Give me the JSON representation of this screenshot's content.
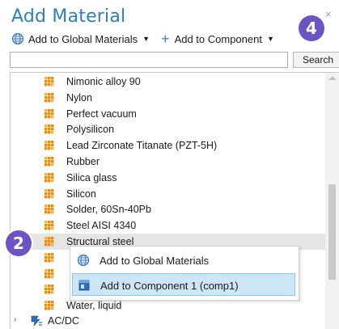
{
  "window": {
    "title": "Add Material",
    "close_glyph": "×"
  },
  "toolbar": {
    "global_label": "Add to Global Materials",
    "global_caret": "▼",
    "component_label": "Add to Component",
    "component_caret": "▼",
    "plus_glyph": "+"
  },
  "search": {
    "value": "",
    "placeholder": "",
    "button_label": "Search"
  },
  "tree": {
    "materials": [
      {
        "label": "Nimonic alloy 90"
      },
      {
        "label": "Nylon"
      },
      {
        "label": "Perfect vacuum"
      },
      {
        "label": "Polysilicon"
      },
      {
        "label": "Lead Zirconate Titanate (PZT-5H)"
      },
      {
        "label": "Rubber"
      },
      {
        "label": "Silica glass"
      },
      {
        "label": "Silicon"
      },
      {
        "label": "Solder, 60Sn-40Pb"
      },
      {
        "label": "Steel AISI 4340"
      },
      {
        "label": "Structural steel"
      },
      {
        "label": ""
      },
      {
        "label": ""
      },
      {
        "label": ""
      },
      {
        "label": "Water, liquid"
      }
    ],
    "folder": {
      "label": "AC/DC",
      "expander": "›"
    },
    "selected_index": 10
  },
  "context_menu": {
    "items": [
      {
        "label": "Add to Global Materials",
        "icon": "globe-icon"
      },
      {
        "label": "Add to Component 1 (comp1)",
        "icon": "component-icon"
      }
    ],
    "highlighted_index": 1
  },
  "badges": {
    "step_2": "2",
    "step_4": "4"
  },
  "colors": {
    "title": "#2a7ec8",
    "material_icon": "#f08c00",
    "badge": "#6c54c4",
    "selection": "#e5e5e5",
    "menu_highlight": "#cce6f7"
  }
}
